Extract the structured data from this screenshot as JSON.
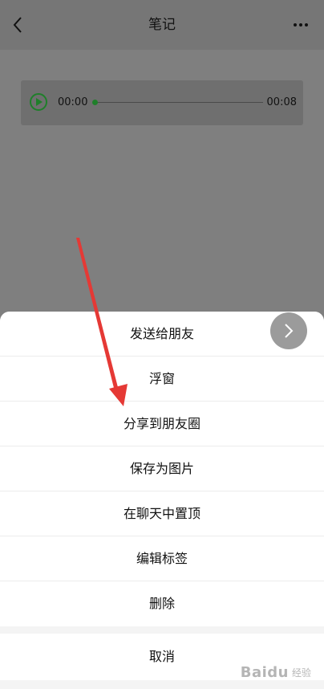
{
  "header": {
    "title": "笔记"
  },
  "audio": {
    "current_time": "00:00",
    "total_time": "00:08",
    "progress": 0
  },
  "sheet": {
    "actions": [
      "发送给朋友",
      "浮窗",
      "分享到朋友圈",
      "保存为图片",
      "在聊天中置顶",
      "编辑标签",
      "删除"
    ],
    "cancel": "取消"
  },
  "watermark": {
    "main": "Baidu",
    "sub": "经验"
  },
  "colors": {
    "accent_green": "#1f7f2a",
    "annotation_red": "#e53935",
    "overlay": "#7f7f7f",
    "sheet_bg": "#ffffff"
  },
  "icons": {
    "back": "chevron-left-icon",
    "more": "more-dots-icon",
    "play": "play-icon",
    "next": "chevron-right-icon"
  }
}
